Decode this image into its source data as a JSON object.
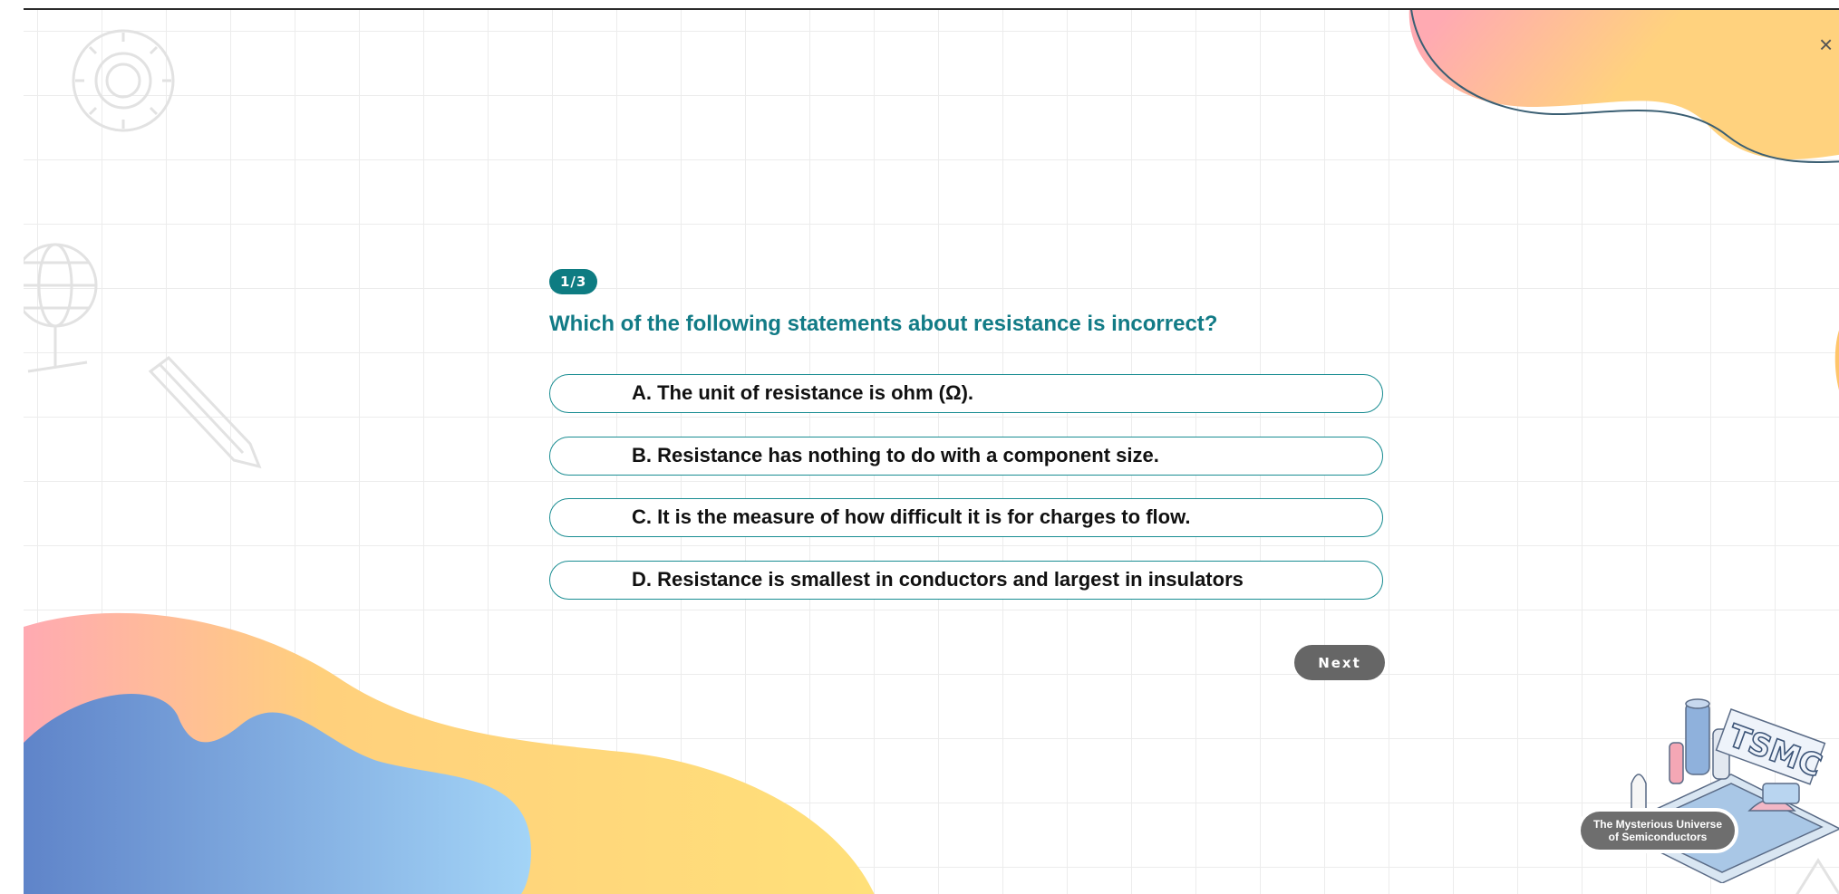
{
  "window": {
    "close_glyph": "×"
  },
  "quiz": {
    "progress": "1/3",
    "question": "Which of the following statements about resistance is incorrect?",
    "options": [
      {
        "label": "A. The unit of resistance is ohm (Ω)."
      },
      {
        "label": "B. Resistance has nothing to do with a component size."
      },
      {
        "label": "C. It is the measure of how difficult it is for charges to flow."
      },
      {
        "label": "D. Resistance is smallest in conductors and largest in insulators"
      }
    ],
    "next_label": "Next"
  },
  "logo": {
    "brand": "TSMC",
    "caption_line1": "The Mysterious Universe",
    "caption_line2": "of Semiconductors"
  },
  "colors": {
    "accent": "#0e7c82",
    "question": "#127b86",
    "next_button": "#666666",
    "blob_blue": "#6b96d6",
    "blob_yellow": "#ffd57a",
    "blob_pink": "#ffaab0"
  },
  "icons": [
    "gear-icon",
    "globe-icon",
    "pencil-icon",
    "close-icon"
  ]
}
